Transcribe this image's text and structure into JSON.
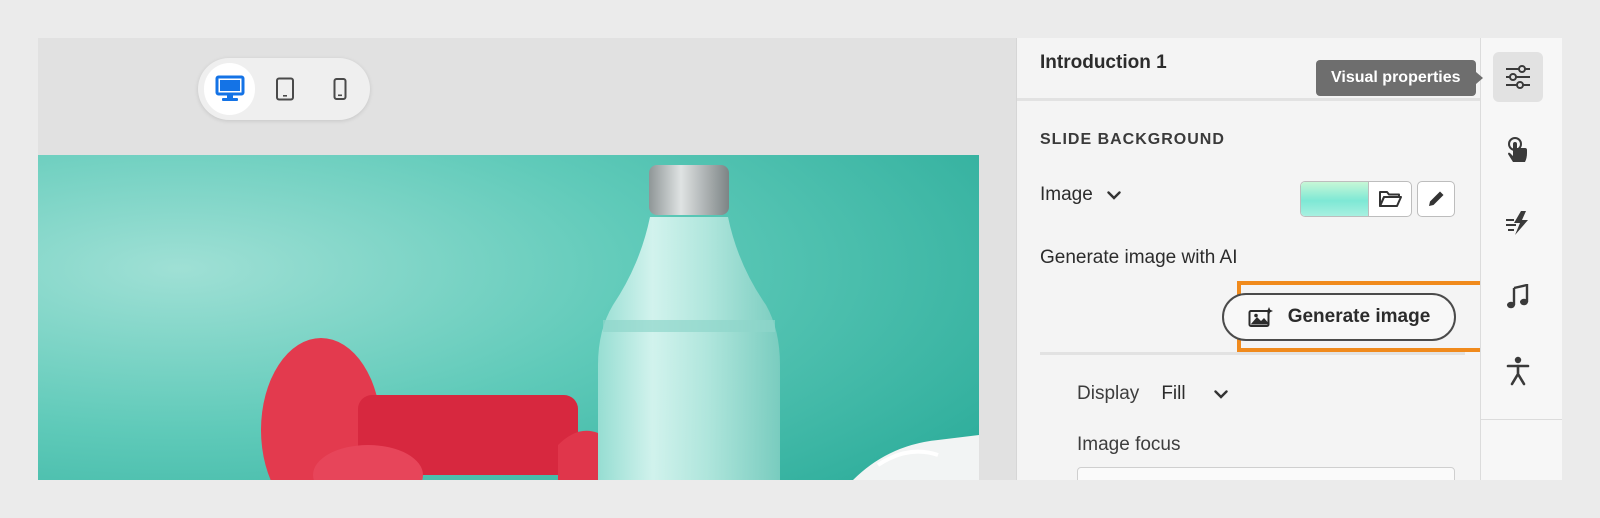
{
  "device_switcher": {
    "options": [
      "desktop-icon",
      "tablet-icon",
      "mobile-icon"
    ],
    "selected": "desktop-icon"
  },
  "panel": {
    "title": "Introduction 1",
    "section_heading": "SLIDE BACKGROUND",
    "background_type": "Image",
    "generate_label": "Generate image with AI",
    "generate_button": "Generate image",
    "display_label": "Display",
    "display_value": "Fill",
    "image_focus_label": "Image focus"
  },
  "tooltip": {
    "text": "Visual properties"
  },
  "rail": {
    "items": [
      "sliders-icon",
      "touch-interaction-icon",
      "effects-icon",
      "music-note-icon",
      "accessibility-icon"
    ],
    "active": "sliders-icon"
  },
  "colors": {
    "accent_blue": "#1473e6",
    "highlight_orange": "#f08a1c",
    "slide_teal": "#5fcab9"
  }
}
